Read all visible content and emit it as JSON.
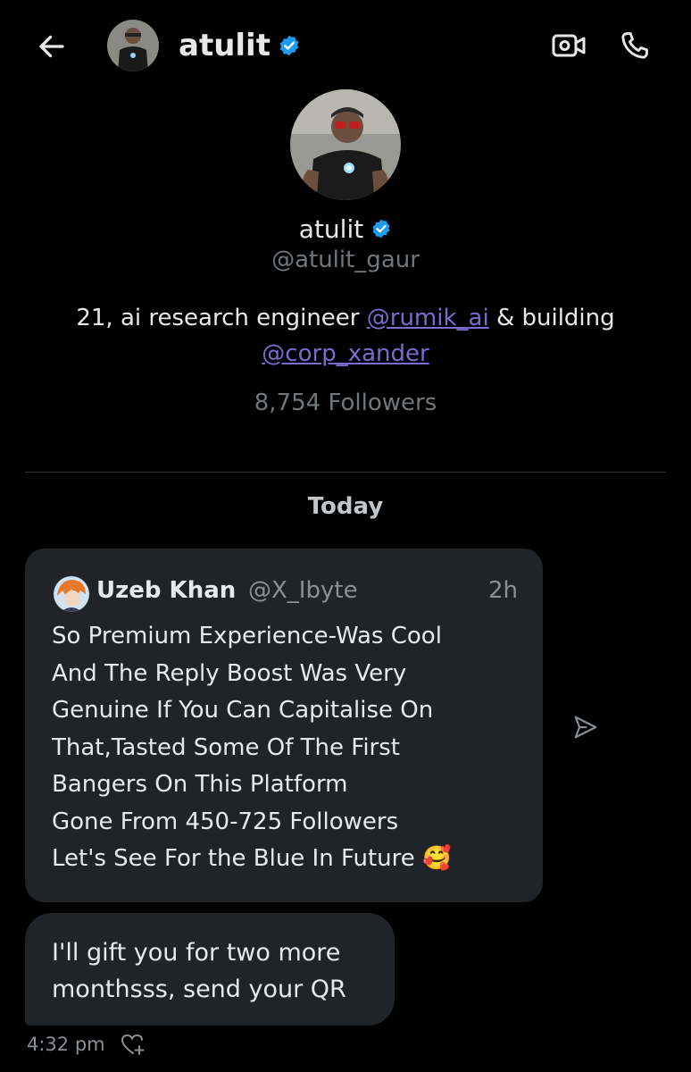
{
  "header": {
    "name": "atulit",
    "back_icon": "arrow-left-icon",
    "video_icon": "video-call-icon",
    "phone_icon": "phone-icon"
  },
  "profile": {
    "name": "atulit",
    "handle": "@atulit_gaur",
    "bio_prefix": "21, ai research engineer ",
    "bio_mention_1": "@rumik_ai",
    "bio_middle": " & building",
    "bio_mention_2": "@corp_xander",
    "followers": "8,754 Followers"
  },
  "conversation": {
    "date_separator": "Today",
    "shared_post": {
      "author_name": "Uzeb Khan",
      "author_handle": "@X_Ibyte",
      "time": "2h",
      "text": "So Premium Experience-Was Cool\nAnd The Reply Boost Was Very\nGenuine If You Can Capitalise On\nThat,Tasted Some Of The First\nBangers On This Platform\nGone From 450-725 Followers\nLet's See For the Blue In Future 🥰"
    },
    "message": {
      "text": "I'll gift you for two more\nmonthsss, send your QR",
      "time": "4:32 pm"
    }
  },
  "colors": {
    "background": "#000000",
    "bubble": "#202327",
    "verified": "#1d9bf0",
    "mention": "#7b6bcf",
    "secondary_text": "#71767b"
  }
}
